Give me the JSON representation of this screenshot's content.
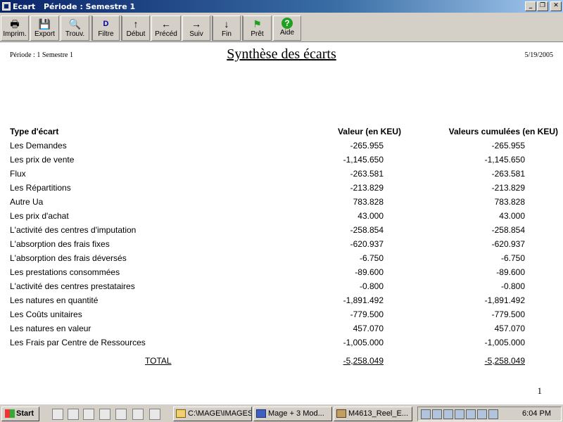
{
  "window": {
    "app_title": "Ecart",
    "period_title": "Période : Semestre 1",
    "minimize": "_",
    "restore": "❐",
    "close": "✕"
  },
  "toolbar": {
    "buttons": [
      {
        "label": "Imprim.",
        "icon": "printer-icon",
        "glyph": "🖶"
      },
      {
        "label": "Export",
        "icon": "floppy-disk-icon",
        "glyph": "💾"
      },
      {
        "label": "Trouv.",
        "icon": "find-icon",
        "glyph": "🔍"
      },
      {
        "label": "Filtre",
        "icon": "filter-icon",
        "glyph": "D"
      },
      {
        "label": "Début",
        "icon": "arrow-up-icon",
        "glyph": "↑"
      },
      {
        "label": "Précéd",
        "icon": "arrow-left-icon",
        "glyph": "←"
      },
      {
        "label": "Suiv",
        "icon": "arrow-right-icon",
        "glyph": "→"
      },
      {
        "label": "Fin",
        "icon": "arrow-down-icon",
        "glyph": "↓"
      },
      {
        "label": "Prêt",
        "icon": "ready-icon",
        "glyph": "⚑"
      },
      {
        "label": "Aide",
        "icon": "help-icon",
        "glyph": "?"
      }
    ]
  },
  "report": {
    "period_label": "Période : 1  Semestre 1",
    "title": "Synthèse des écarts",
    "date": "5/19/2005",
    "headers": {
      "type": "Type d'écart",
      "value": "Valeur (en KEU)",
      "cumulative": "Valeurs cumulées (en KEU)"
    },
    "rows": [
      {
        "type": "Les Demandes",
        "value": "-265.955",
        "cumulative": "-265.955"
      },
      {
        "type": "Les prix de vente",
        "value": "-1,145.650",
        "cumulative": "-1,145.650"
      },
      {
        "type": "Flux",
        "value": "-263.581",
        "cumulative": "-263.581"
      },
      {
        "type": "Les Répartitions",
        "value": "-213.829",
        "cumulative": "-213.829"
      },
      {
        "type": "Autre Ua",
        "value": "783.828",
        "cumulative": "783.828"
      },
      {
        "type": "Les prix d'achat",
        "value": "43.000",
        "cumulative": "43.000"
      },
      {
        "type": "L'activité des centres d'imputation",
        "value": "-258.854",
        "cumulative": "-258.854"
      },
      {
        "type": "L'absorption des frais fixes",
        "value": "-620.937",
        "cumulative": "-620.937"
      },
      {
        "type": "L'absorption des frais déversés",
        "value": "-6.750",
        "cumulative": "-6.750"
      },
      {
        "type": "Les prestations consommées",
        "value": "-89.600",
        "cumulative": "-89.600"
      },
      {
        "type": "L'activité des centres prestataires",
        "value": "-0.800",
        "cumulative": "-0.800"
      },
      {
        "type": "Les natures en quantité",
        "value": "-1,891.492",
        "cumulative": "-1,891.492"
      },
      {
        "type": "Les Coûts unitaires",
        "value": "-779.500",
        "cumulative": "-779.500"
      },
      {
        "type": "Les natures en valeur",
        "value": "457.070",
        "cumulative": "457.070"
      },
      {
        "type": "Les Frais par Centre de Ressources",
        "value": "-1,005.000",
        "cumulative": "-1,005.000"
      }
    ],
    "total": {
      "label": "TOTAL",
      "value": "-5,258.049",
      "cumulative": "-5,258.049"
    },
    "page_number": "1"
  },
  "taskbar": {
    "start_label": "Start",
    "tasks": [
      {
        "label": "C:\\MAGE\\IMAGES",
        "icon": "folder-icon"
      },
      {
        "label": "Mage + 3   Mod...",
        "icon": "app-icon"
      },
      {
        "label": "M4613_Reel_E...",
        "icon": "report-icon"
      }
    ],
    "clock": "6:04 PM"
  }
}
